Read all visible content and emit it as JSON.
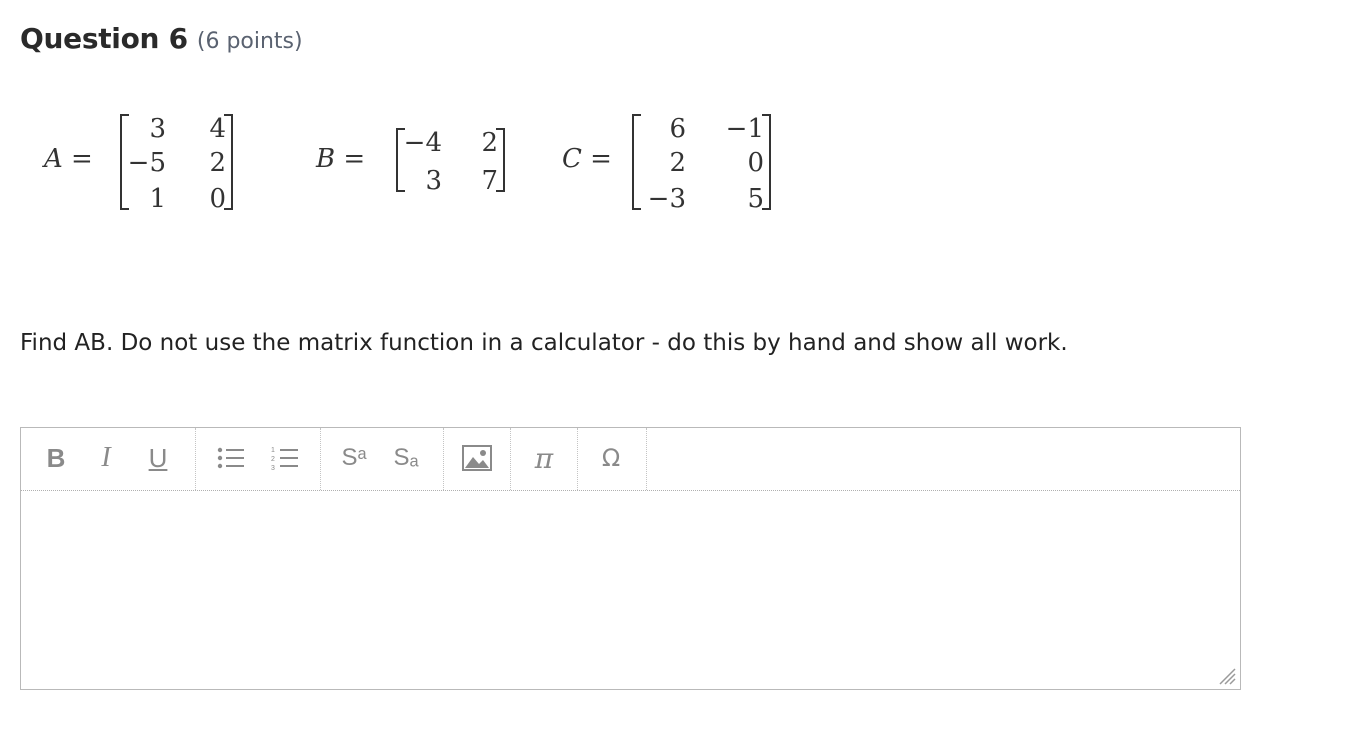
{
  "question": {
    "title": "Question 6",
    "points": "(6 points)"
  },
  "matrices": {
    "A": {
      "label": "A =",
      "rows": [
        [
          "3",
          "4"
        ],
        [
          "−5",
          "2"
        ],
        [
          "1",
          "0"
        ]
      ]
    },
    "B": {
      "label": "B =",
      "rows": [
        [
          "−4",
          "2"
        ],
        [
          "3",
          "7"
        ]
      ]
    },
    "C": {
      "label": "C =",
      "rows": [
        [
          "6",
          "−1"
        ],
        [
          "2",
          "0"
        ],
        [
          "−3",
          "5"
        ]
      ]
    }
  },
  "instruction": "Find AB. Do not use the matrix function in a calculator - do this by hand and show all work.",
  "toolbar": {
    "bold": "B",
    "italic": "I",
    "underline": "U",
    "superscript": "Sᵃ",
    "subscript": "Sₐ",
    "pi": "π",
    "omega": "Ω"
  },
  "icons": [
    "bold-icon",
    "italic-icon",
    "underline-icon",
    "bullet-list-icon",
    "numbered-list-icon",
    "superscript-icon",
    "subscript-icon",
    "image-icon",
    "pi-icon",
    "omega-icon",
    "resize-handle-icon"
  ],
  "answer": {
    "value": ""
  }
}
